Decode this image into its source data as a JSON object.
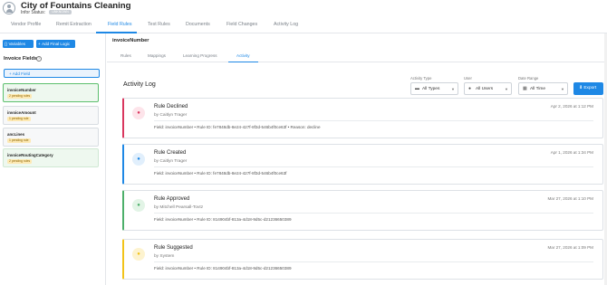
{
  "header": {
    "company_name": "City of Fountains Cleaning",
    "status_label": "Infor Status:",
    "status_badge": "UNKNOWN"
  },
  "top_tabs": [
    {
      "label": "Vendor Profile"
    },
    {
      "label": "Remit Extraction"
    },
    {
      "label": "Field Rules",
      "active": true
    },
    {
      "label": "Test Rules"
    },
    {
      "label": "Documents"
    },
    {
      "label": "Field Changes"
    },
    {
      "label": "Activity Log"
    }
  ],
  "left_panel": {
    "variables_button": "Variables",
    "add_logic_button": "Add Final Logic",
    "invoice_fields_title": "Invoice Fields",
    "add_field_button": "Add Field",
    "fields": [
      {
        "name": "invoiceNumber",
        "pending": "2 pending rules",
        "selected": true
      },
      {
        "name": "invoiceAmount",
        "pending": "1 pending rule"
      },
      {
        "name": "ancLines",
        "pending": "1 pending rule"
      },
      {
        "name": "invoiceRoutingCategory",
        "pending": "2 pending rules"
      }
    ]
  },
  "main": {
    "field_title": "invoiceNumber",
    "sub_tabs": [
      {
        "label": "Rules"
      },
      {
        "label": "Mappings"
      },
      {
        "label": "Learning Progress"
      },
      {
        "label": "Activity",
        "active": true
      }
    ],
    "activity_log_title": "Activity Log",
    "filters": {
      "activity_type": {
        "label": "Activity Type",
        "value": "All Types"
      },
      "user": {
        "label": "User",
        "value": "All Users"
      },
      "date_range": {
        "label": "Date Range",
        "value": "All Time"
      }
    },
    "export_button": "Export",
    "activities": [
      {
        "title": "Rule Declined",
        "by": "by Caitlyn Trager",
        "date": "Apr 2, 2026 at 1:12 PM",
        "detail": "Field: invoiceNumber • Rule ID: fe7848db-8e24-427f-8f3d-546b4f0ce63f • Reason: decline",
        "accent": "#d9365e",
        "icon_bg": "#fde4ea",
        "icon": "user-icon"
      },
      {
        "title": "Rule Created",
        "by": "by Caitlyn Trager",
        "date": "Apr 1, 2026 at 1:34 PM",
        "detail": "Field: invoiceNumber • Rule ID: fe7848db-8e24-427f-8f3d-546b4f0ce63f",
        "accent": "#1e88e5",
        "icon_bg": "#e1effc",
        "icon": "user-icon"
      },
      {
        "title": "Rule Approved",
        "by": "by Mitchell Pearsall-Tovtz",
        "date": "Mar 27, 2026 at 1:10 PM",
        "detail": "Field: invoiceNumber • Rule ID: 814904bf-813a-4d18-9d5c-d21236650389",
        "accent": "#4caf6a",
        "icon_bg": "#e2f4e6",
        "icon": "user-icon"
      },
      {
        "title": "Rule Suggested",
        "by": "by System",
        "date": "Mar 27, 2026 at 1:09 PM",
        "detail": "Field: invoiceNumber • Rule ID: 814904bf-813a-4d18-9d5c-d21236650389",
        "accent": "#f2c318",
        "icon_bg": "#fdf3cf",
        "icon": "user-icon"
      }
    ]
  },
  "colors": {
    "primary": "#1e88e5",
    "pending_badge": "#fde9b4"
  }
}
